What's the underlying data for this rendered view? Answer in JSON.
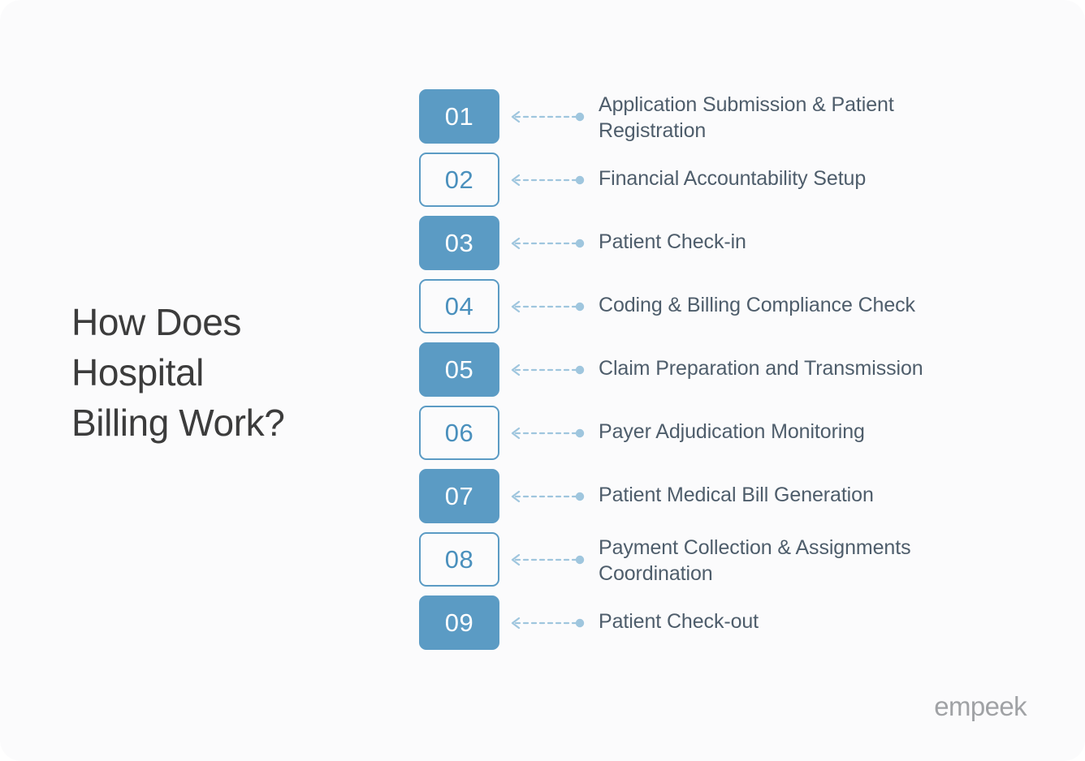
{
  "page": {
    "background_color": "#fbfbfc",
    "title": "How Does\nHospital\nBilling Work?",
    "title_color": "#3c3c3c"
  },
  "theme": {
    "accent_blue": "#5b9bc4",
    "outline_number_color": "#4a90bd",
    "label_color": "#4e5d6b",
    "connector_color": "#9fc6de",
    "logo_color": "#a0a2a5"
  },
  "steps": [
    {
      "number": "01",
      "label": "Application Submission & Patient\nRegistration",
      "style": "filled"
    },
    {
      "number": "02",
      "label": "Financial Accountability Setup",
      "style": "outlined"
    },
    {
      "number": "03",
      "label": "Patient Check-in",
      "style": "filled"
    },
    {
      "number": "04",
      "label": "Coding & Billing Compliance Check",
      "style": "outlined"
    },
    {
      "number": "05",
      "label": "Claim Preparation and Transmission",
      "style": "filled"
    },
    {
      "number": "06",
      "label": "Payer Adjudication Monitoring",
      "style": "outlined"
    },
    {
      "number": "07",
      "label": "Patient Medical Bill Generation",
      "style": "filled"
    },
    {
      "number": "08",
      "label": "Payment Collection & Assignments\nCoordination",
      "style": "outlined"
    },
    {
      "number": "09",
      "label": "Patient Check-out",
      "style": "filled"
    }
  ],
  "brand": {
    "logo_text": "empeek"
  }
}
